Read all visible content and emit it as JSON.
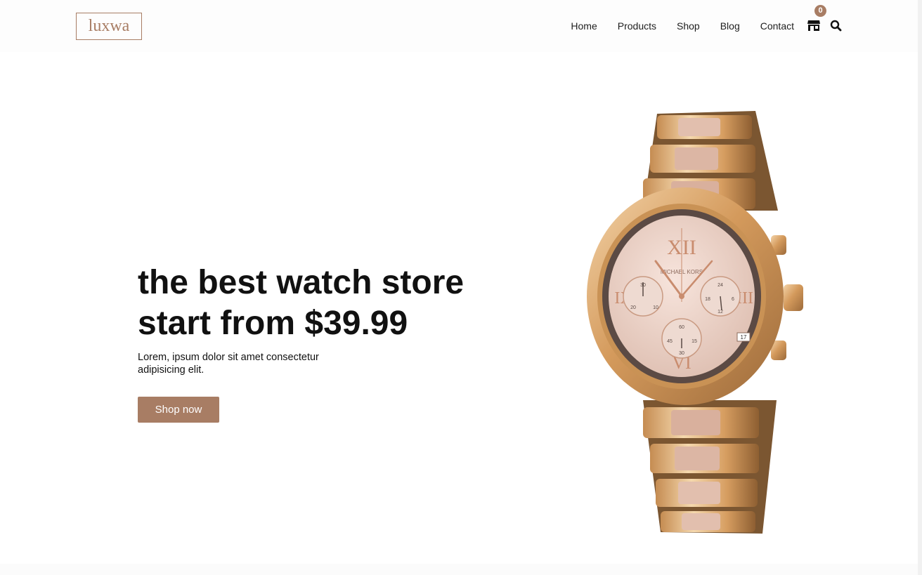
{
  "brand": {
    "logo_text": "luxwa",
    "accent_color": "#a87d64"
  },
  "nav": {
    "items": [
      "Home",
      "Products",
      "Shop",
      "Blog",
      "Contact"
    ],
    "cart_icon": "store-icon",
    "cart_count": "0",
    "search_icon": "search-icon"
  },
  "hero": {
    "title_line1": "the best watch store",
    "title_line2": "start from $39.99",
    "description": "Lorem, ipsum dolor sit amet consectetur adipisicing elit.",
    "cta_label": "Shop now"
  },
  "watch_image": {
    "brand_text": "MICHAEL KORS",
    "hour_markers": [
      "XII",
      "III",
      "VI",
      "IX"
    ],
    "subdial_left": [
      "30",
      "20",
      "10"
    ],
    "subdial_right": [
      "24",
      "18",
      "6",
      "12"
    ],
    "subdial_bottom": [
      "60",
      "45",
      "15",
      "30"
    ],
    "date": "17"
  }
}
